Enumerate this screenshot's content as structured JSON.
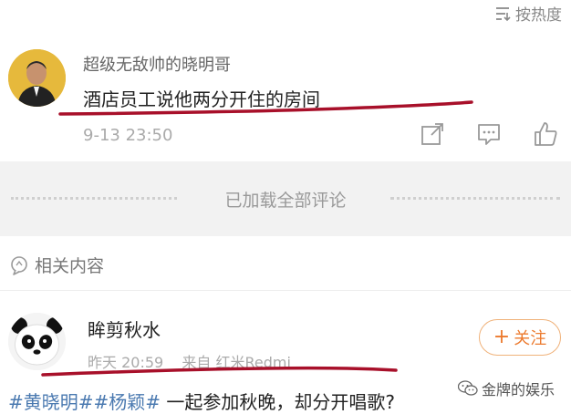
{
  "sort": {
    "label": "按热度",
    "icon": "sort-icon"
  },
  "comment": {
    "username": "超级无敌帅的晓明哥",
    "text": "酒店员工说他两分开住的房间",
    "timestamp": "9-13 23:50",
    "actions": [
      "share-icon",
      "reply-icon",
      "like-icon"
    ]
  },
  "divider": {
    "text": "已加载全部评论"
  },
  "related": {
    "label": "相关内容",
    "icon": "bubble-icon"
  },
  "post": {
    "username": "眸剪秋水",
    "time": "昨天 20:59",
    "source": "来自 红米Redmi",
    "follow_label": "关注",
    "tag1": "#黄晓明#",
    "tag2": "#杨颖#",
    "text": "一起参加秋晚，却分开唱歌?"
  },
  "watermark": {
    "text": "金牌的娱乐",
    "icon": "wechat-icon"
  },
  "colors": {
    "tag": "#4a79b0",
    "follow": "#ec7a2e",
    "annotation": "#b0122d"
  }
}
